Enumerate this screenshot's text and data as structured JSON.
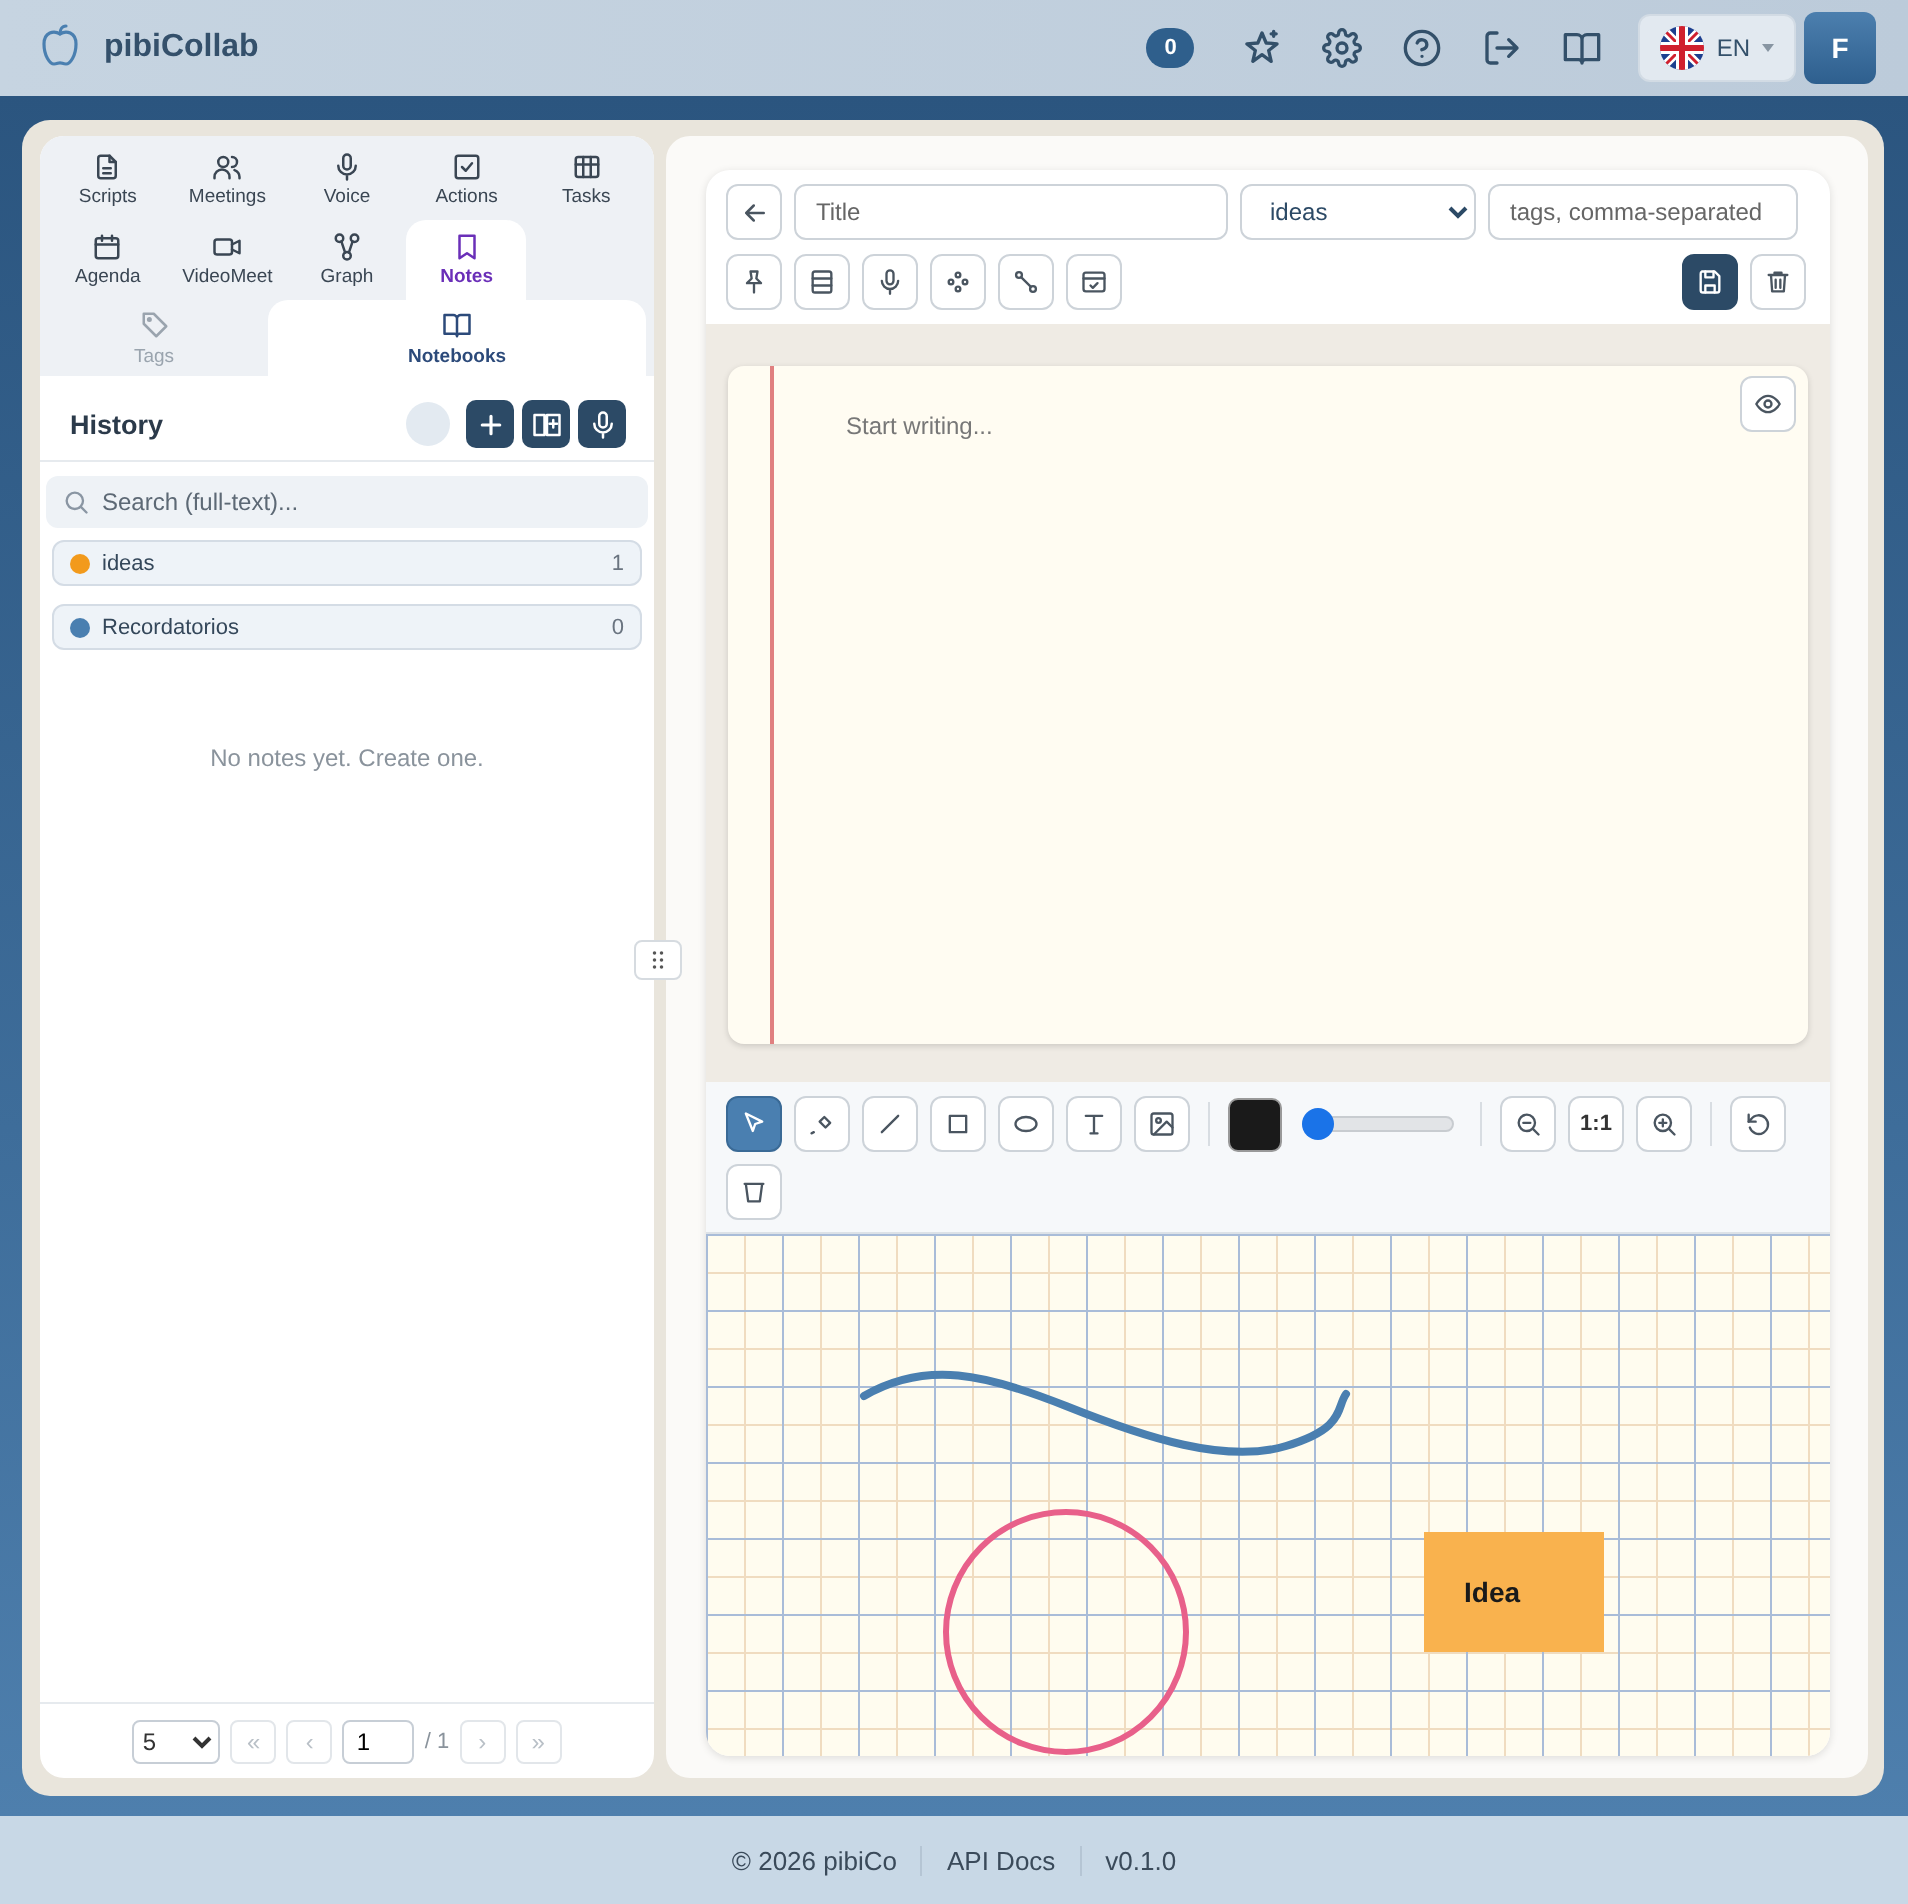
{
  "header": {
    "app_name": "pibiCollab",
    "badge": "0",
    "language": "EN",
    "avatar": "F"
  },
  "nav": {
    "tabs": [
      {
        "label": "Scripts",
        "selected": false
      },
      {
        "label": "Meetings",
        "selected": false
      },
      {
        "label": "Voice",
        "selected": false
      },
      {
        "label": "Actions",
        "selected": false
      },
      {
        "label": "Tasks",
        "selected": false
      },
      {
        "label": "Agenda",
        "selected": false
      },
      {
        "label": "VideoMeet",
        "selected": false
      },
      {
        "label": "Graph",
        "selected": false
      },
      {
        "label": "Notes",
        "selected": true
      }
    ],
    "sub_tabs": [
      {
        "label": "Tags",
        "selected": false
      },
      {
        "label": "Notebooks",
        "selected": true
      }
    ]
  },
  "history": {
    "title": "History",
    "search": {
      "placeholder": "Search (full-text)..."
    },
    "notebooks": [
      {
        "name": "ideas",
        "count": "1",
        "color": "#f29a1c"
      },
      {
        "name": "Recordatorios",
        "count": "0",
        "color": "#4a7fb0"
      }
    ],
    "empty_text": "No notes yet. Create one.",
    "pagination": {
      "page_size": "5",
      "page": "1",
      "total": "/ 1",
      "before": [
        {
          "label": "«",
          "disabled": true
        },
        {
          "label": "‹",
          "disabled": true
        }
      ],
      "after": [
        {
          "label": "›",
          "disabled": true
        },
        {
          "label": "»",
          "disabled": true
        }
      ]
    }
  },
  "editor": {
    "title": {
      "placeholder": "Title"
    },
    "notebook": "ideas",
    "tags": {
      "placeholder": "tags, comma-separated"
    },
    "body": {
      "placeholder": "Start writing..."
    }
  },
  "drawing": {
    "tools": [
      {
        "kind": "select",
        "selected": true
      },
      {
        "kind": "pen",
        "selected": false
      },
      {
        "kind": "line",
        "selected": false
      },
      {
        "kind": "rect",
        "selected": false
      },
      {
        "kind": "ellipse",
        "selected": false
      },
      {
        "kind": "text",
        "selected": false
      },
      {
        "kind": "image",
        "selected": false
      }
    ],
    "stroke_width": {
      "level": 0.04
    },
    "zoom_reset": "1:1",
    "shapes": [
      {
        "kind": "stroke",
        "color": "#4a7fb0"
      },
      {
        "kind": "ellipse",
        "color": "#e8608a"
      },
      {
        "kind": "rect",
        "color": "#f9b24e",
        "label": "Idea"
      }
    ]
  },
  "footer": {
    "links": [
      "© 2026 pibiCo",
      "API Docs",
      "v0.1.0"
    ]
  }
}
